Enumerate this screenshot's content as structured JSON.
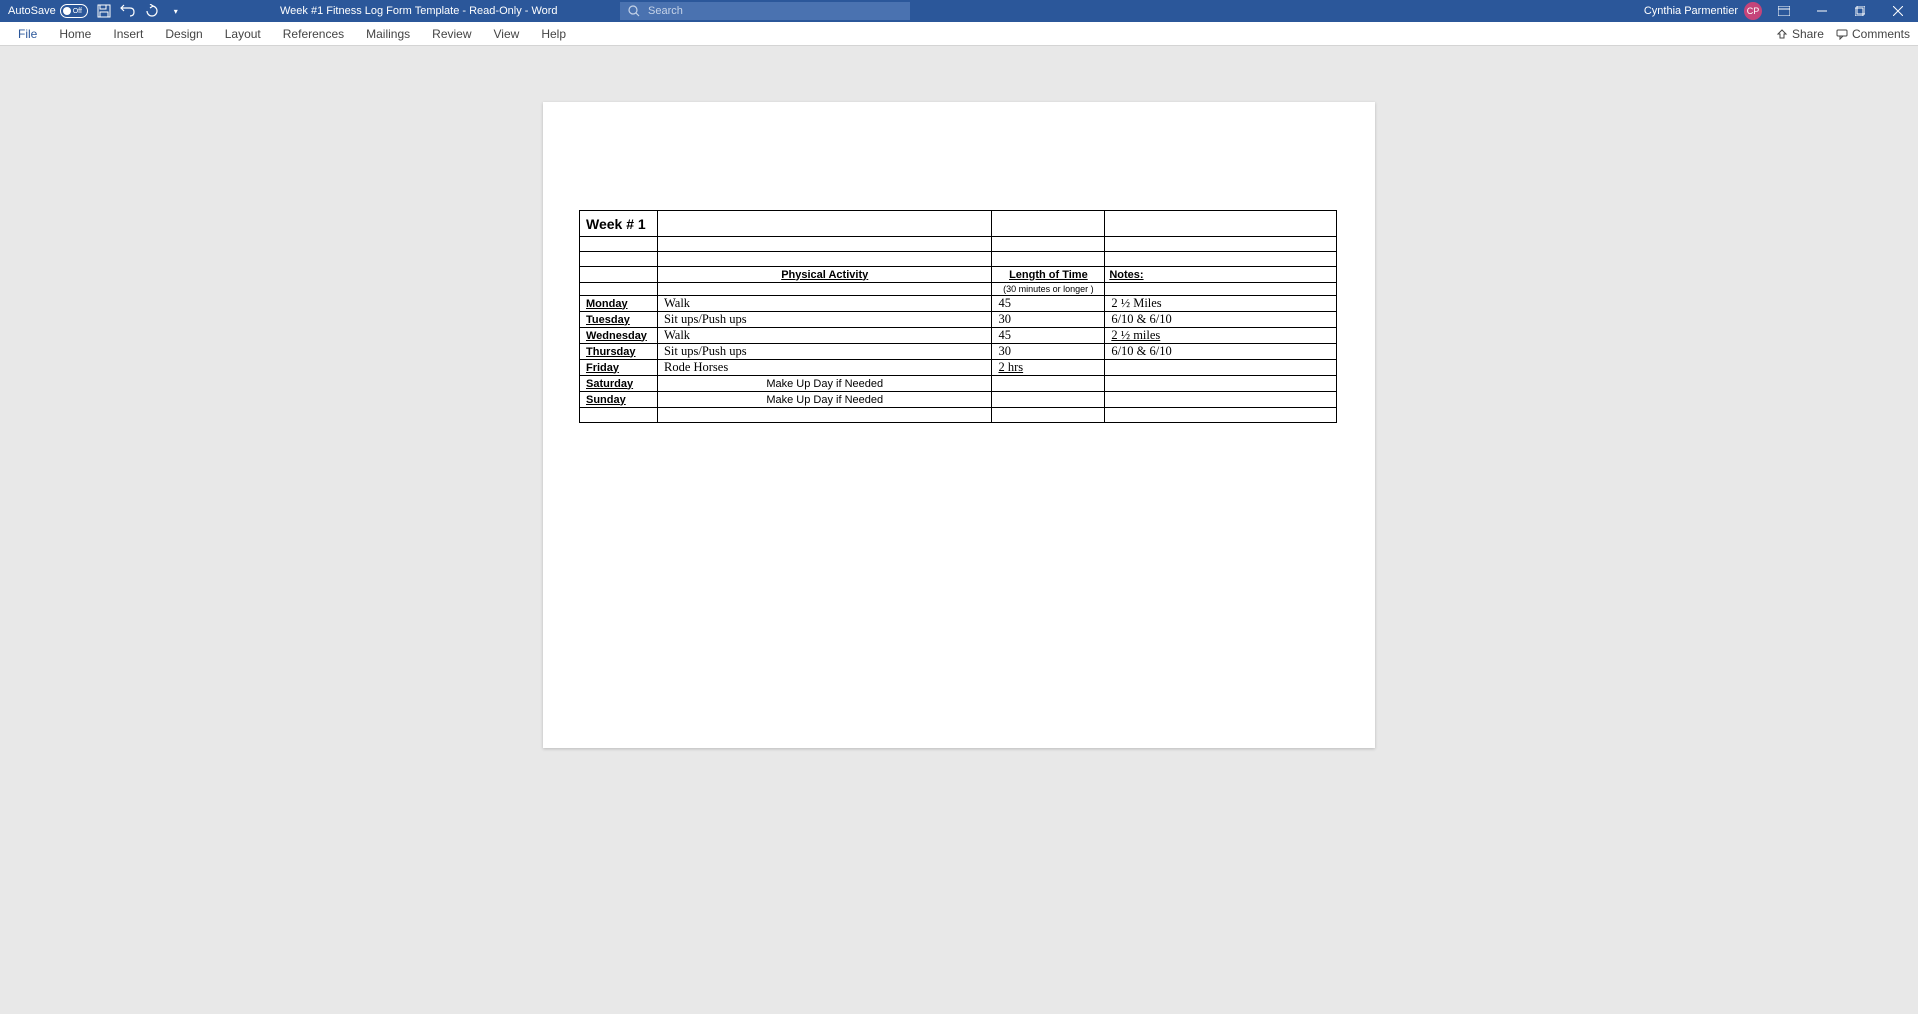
{
  "titlebar": {
    "autosave": "AutoSave",
    "autosave_state": "Off",
    "document_title": "Week #1 Fitness Log Form Template  -  Read-Only  -  Word",
    "search_placeholder": "Search",
    "user_name": "Cynthia Parmentier",
    "user_initials": "CP"
  },
  "ribbon": {
    "tabs": [
      "File",
      "Home",
      "Insert",
      "Design",
      "Layout",
      "References",
      "Mailings",
      "Review",
      "View",
      "Help"
    ],
    "share": "Share",
    "comments": "Comments"
  },
  "table": {
    "week_title": "Week # 1",
    "headers": {
      "activity": "Physical Activity",
      "length": "Length of Time",
      "length_sub": "(30 minutes or longer )",
      "notes": "Notes:"
    },
    "rows": [
      {
        "day": "Monday",
        "activity": "Walk",
        "length": "45",
        "notes": "2  ½ Miles"
      },
      {
        "day": "Tuesday",
        "activity": "Sit ups/Push ups",
        "length": "30",
        "notes": "6/10 & 6/10"
      },
      {
        "day": "Wednesday",
        "activity": "Walk",
        "length": "45",
        "notes": "2 ½ miles"
      },
      {
        "day": "Thursday",
        "activity": "Sit ups/Push ups",
        "length": "30",
        "notes": "6/10 & 6/10"
      },
      {
        "day": "Friday",
        "activity": "Rode Horses",
        "length": "2 hrs",
        "notes": ""
      },
      {
        "day": "Saturday",
        "activity": "Make Up Day if Needed",
        "length": "",
        "notes": ""
      },
      {
        "day": "Sunday",
        "activity": "Make Up Day if Needed",
        "length": "",
        "notes": ""
      }
    ]
  }
}
